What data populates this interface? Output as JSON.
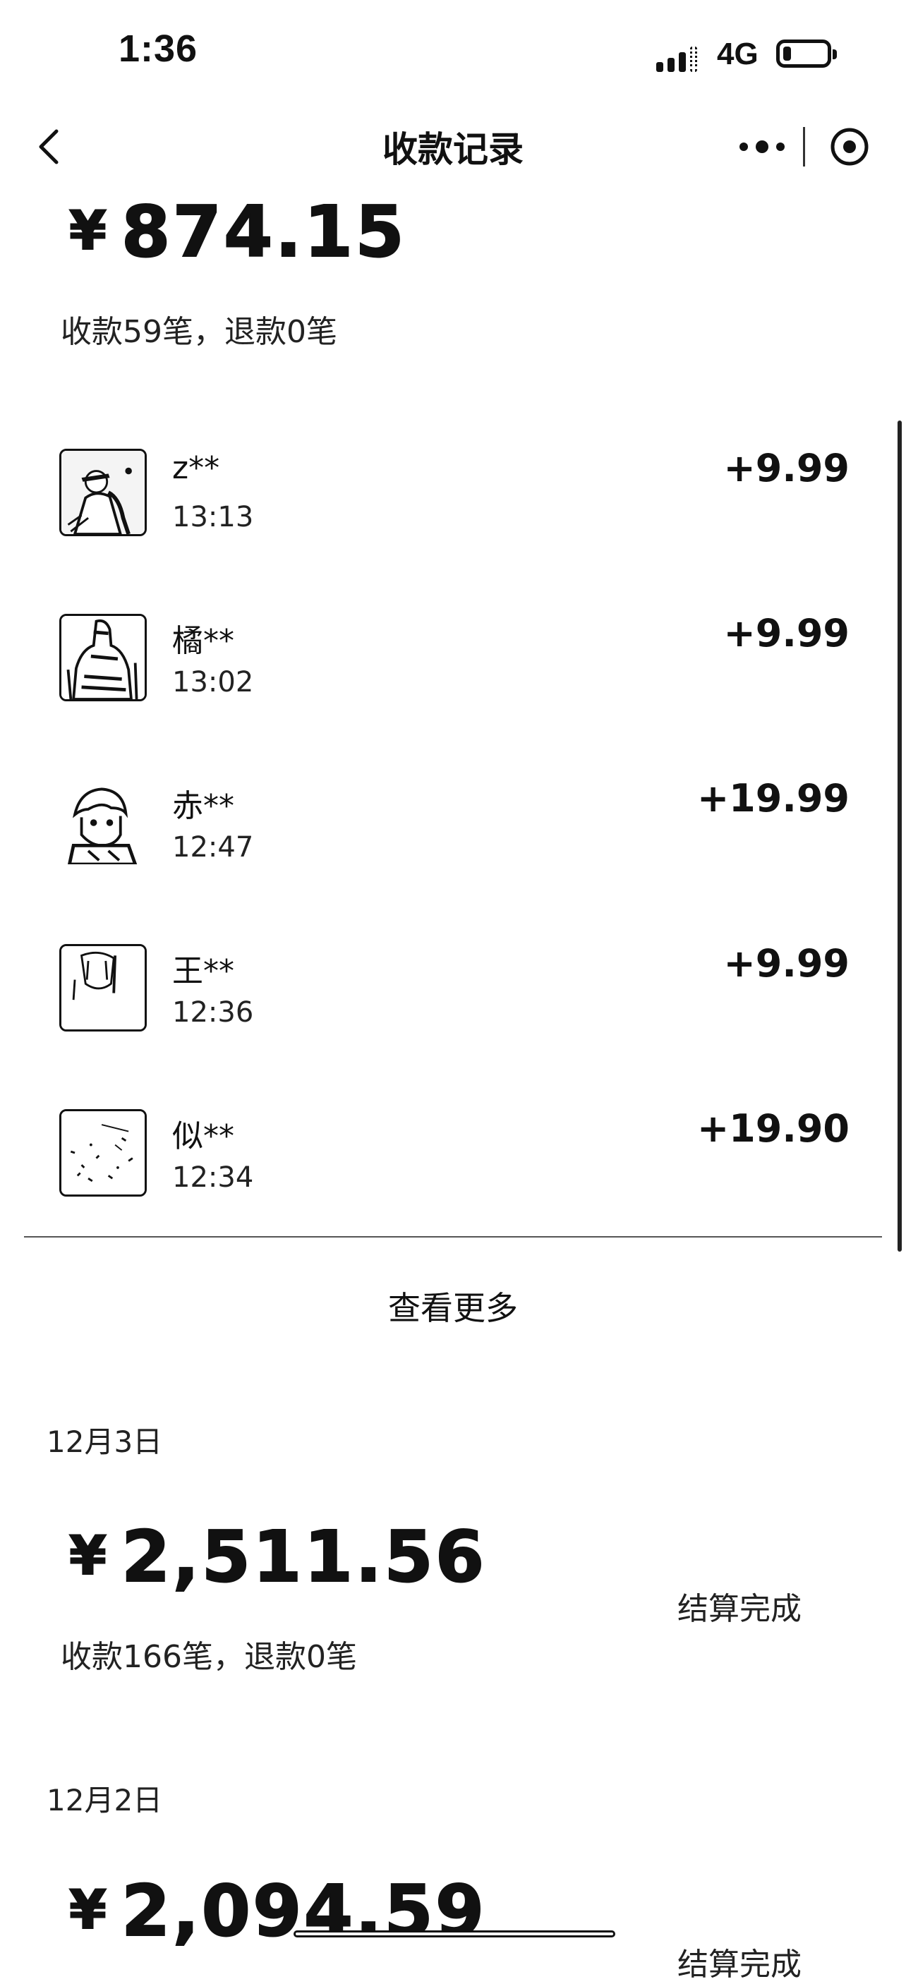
{
  "status_bar": {
    "time": "1:36",
    "network": "4G"
  },
  "nav": {
    "title": "收款记录"
  },
  "today": {
    "amount": "874.15",
    "currency": "¥",
    "summary": "收款59笔，退款0笔"
  },
  "transactions": [
    {
      "name": "z**",
      "time": "13:13",
      "amount": "+9.99"
    },
    {
      "name": "橘**",
      "time": "13:02",
      "amount": "+9.99"
    },
    {
      "name": "赤**",
      "time": "12:47",
      "amount": "+19.99"
    },
    {
      "name": "王**",
      "time": "12:36",
      "amount": "+9.99"
    },
    {
      "name": "似**",
      "time": "12:34",
      "amount": "+19.90"
    }
  ],
  "view_more": "查看更多",
  "days": [
    {
      "date": "12月3日",
      "currency": "¥",
      "amount": "2,511.56",
      "summary": "收款166笔，退款0笔",
      "status": "结算完成"
    },
    {
      "date": "12月2日",
      "currency": "¥",
      "amount": "2,094.59",
      "status": "结算完成"
    }
  ]
}
